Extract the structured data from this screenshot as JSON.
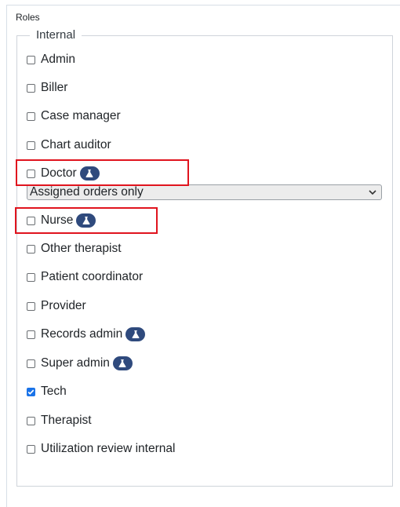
{
  "section": {
    "title": "Roles"
  },
  "group": {
    "legend": "Internal"
  },
  "roles": [
    {
      "label": "Admin",
      "checked": false,
      "beta": false
    },
    {
      "label": "Biller",
      "checked": false,
      "beta": false
    },
    {
      "label": "Case manager",
      "checked": false,
      "beta": false
    },
    {
      "label": "Chart auditor",
      "checked": false,
      "beta": false
    },
    {
      "label": "Doctor",
      "checked": false,
      "beta": true
    },
    {
      "label": "Nurse",
      "checked": false,
      "beta": true
    },
    {
      "label": "Other therapist",
      "checked": false,
      "beta": false
    },
    {
      "label": "Patient coordinator",
      "checked": false,
      "beta": false
    },
    {
      "label": "Provider",
      "checked": false,
      "beta": false
    },
    {
      "label": "Records admin",
      "checked": false,
      "beta": true
    },
    {
      "label": "Super admin",
      "checked": false,
      "beta": true
    },
    {
      "label": "Tech",
      "checked": true,
      "beta": false
    },
    {
      "label": "Therapist",
      "checked": false,
      "beta": false
    },
    {
      "label": "Utilization review internal",
      "checked": false,
      "beta": false
    }
  ],
  "doctor_scope": {
    "selected": "Assigned orders only"
  },
  "icons": {
    "beta": "flask-icon",
    "checkbox_checked": "checkmark-icon",
    "select": "chevron-down-icon"
  },
  "colors": {
    "checked": "#1a73e8",
    "beta_badge": "#2f4a7d",
    "highlight": "#e0141e"
  }
}
